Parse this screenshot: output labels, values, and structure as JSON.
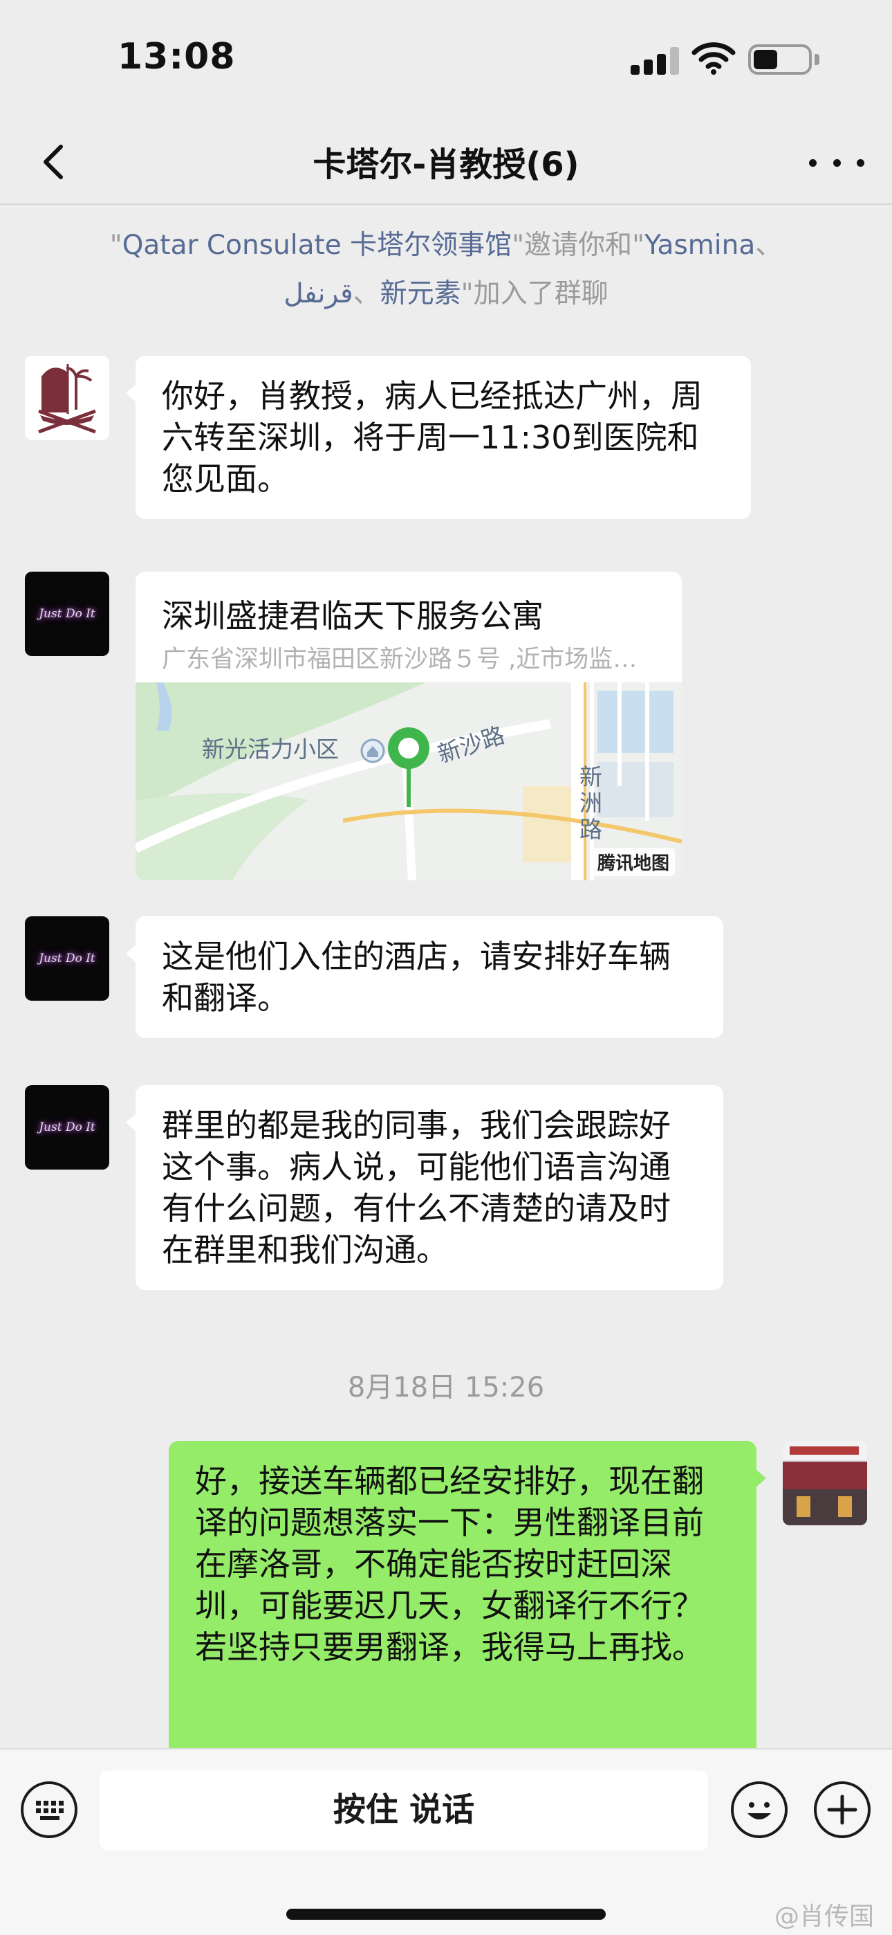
{
  "status_bar": {
    "time": "13:08",
    "battery_level": 0.4
  },
  "nav": {
    "title": "卡塔尔-肖教授(6)",
    "back_icon": "chevron-left-icon",
    "more_icon": "more-dots-icon"
  },
  "notice": {
    "q1": "\"",
    "inviter": "Qatar Consulate 卡塔尔领事馆",
    "q2": "\"",
    "mid": "邀请你和",
    "q3": "\"",
    "member1": "Yasmina",
    "sep1": "、",
    "member2": "قرنفل",
    "sep2": "、",
    "member3": "新元素",
    "q4": "\"",
    "tail": "加入了群聊"
  },
  "messages": [
    {
      "sender_avatar": "qatar-emblem-avatar",
      "text": "你好，肖教授，病人已经抵达广州，周六转至深圳，将于周一11:30到医院和您见面。"
    },
    {
      "sender_avatar": "just-do-it-avatar",
      "type": "location",
      "title": "深圳盛捷君临天下服务公寓",
      "address": "广东省深圳市福田区新沙路５号 ,近市场监…",
      "map_labels": {
        "community": "新光活力小区",
        "road1": "新沙路",
        "road2": "新洲路"
      },
      "map_brand": "腾讯地图"
    },
    {
      "sender_avatar": "just-do-it-avatar",
      "text": "这是他们入住的酒店，请安排好车辆和翻译。"
    },
    {
      "sender_avatar": "just-do-it-avatar",
      "text": "群里的都是我的同事，我们会跟踪好这个事。病人说，可能他们语言沟通有什么问题，有什么不清楚的请及时在群里和我们沟通。"
    },
    {
      "sender_avatar": "self-avatar",
      "text": "好，接送车辆都已经安排好，现在翻译的问题想落实一下：男性翻译目前在摩洛哥，不确定能否按时赶回深圳，可能要迟几天，女翻译行不行？若坚持只要男翻译，我得马上再找。"
    }
  ],
  "avatar_text": {
    "just_do_it": "Just Do It"
  },
  "timestamp": "8月18日 15:26",
  "input_bar": {
    "talk_label": "按住 说话",
    "keyboard_icon": "keyboard-icon",
    "emoji_icon": "emoji-icon",
    "plus_icon": "plus-icon"
  },
  "watermark": "@肖传国",
  "colors": {
    "background": "#ededed",
    "self_bubble": "#95ec69",
    "link": "#576b95"
  }
}
